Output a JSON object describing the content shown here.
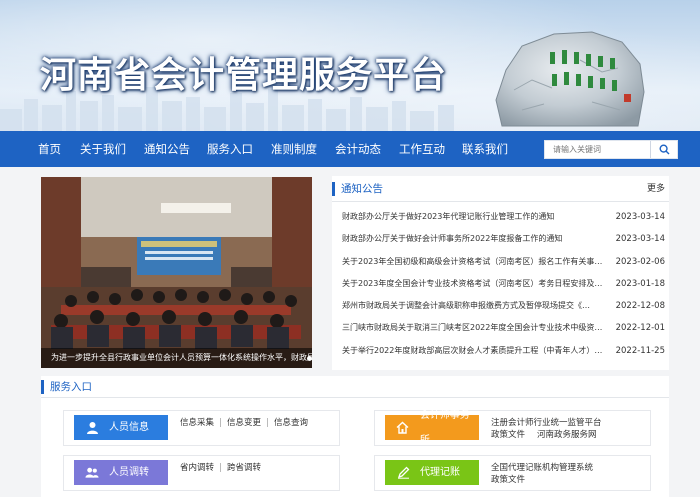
{
  "site": {
    "title": "河南省会计管理服务平台"
  },
  "nav": {
    "items": [
      "首页",
      "关于我们",
      "通知公告",
      "服务入口",
      "准则制度",
      "会计动态",
      "工作互动",
      "联系我们"
    ],
    "search_placeholder": "请输入关键词"
  },
  "carousel": {
    "caption": "为进一步提升全县行政事业单位会计人员预算一体化系统操作水平，财政局预算一体化系统培训",
    "active_index": 0,
    "dot_count": 3
  },
  "notice": {
    "title": "通知公告",
    "more": "更多",
    "items": [
      {
        "title": "财政部办公厅关于做好2023年代理记账行业管理工作的通知",
        "date": "2023-03-14"
      },
      {
        "title": "财政部办公厅关于做好会计师事务所2022年度报备工作的通知",
        "date": "2023-03-14"
      },
      {
        "title": "关于2023年全国初级和高级会计资格考试（河南考区）报名工作有关事项的通知",
        "date": "2023-02-06"
      },
      {
        "title": "关于2023年度全国会计专业技术资格考试（河南考区）考务日程安排及有关事项的通知",
        "date": "2023-01-18"
      },
      {
        "title": "郑州市财政局关于调整会计高级职称申报缴费方式及暂停现场提交《…",
        "date": "2022-12-08"
      },
      {
        "title": "三门峡市财政局关于取消三门峡考区2022年度全国会计专业技术中级资格考试的通知",
        "date": "2022-12-01"
      },
      {
        "title": "关于举行2022年度财政部高层次财会人才素质提升工程（中青年人才）选拔考试的通知",
        "date": "2022-11-25"
      }
    ]
  },
  "service": {
    "title": "服务入口",
    "cards": [
      {
        "label": "人员信息",
        "color": "#2b7ddf",
        "icon": "user-icon",
        "links": [
          "信息采集",
          "信息变更",
          "信息查询"
        ]
      },
      {
        "label": "会计师事务所",
        "color": "#f39a1d",
        "icon": "home-icon",
        "links": [
          "注册会计师行业统一监管平台",
          "政策文件",
          "河南政务服务网"
        ]
      },
      {
        "label": "人员调转",
        "color": "#7b78d8",
        "icon": "users-icon",
        "links": [
          "省内调转",
          "跨省调转"
        ]
      },
      {
        "label": "代理记账",
        "color": "#7ac516",
        "icon": "pen-icon",
        "links": [
          "全国代理记账机构管理系统",
          "政策文件"
        ]
      }
    ]
  },
  "colors": {
    "nav": "#1e63c3",
    "accent": "#1e63c3"
  }
}
